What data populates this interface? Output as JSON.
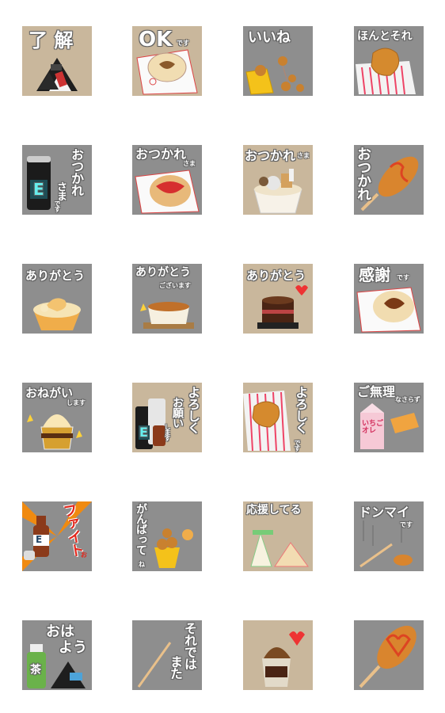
{
  "stickers": [
    {
      "id": "s1",
      "bg": "#c9b79c",
      "text": "了 解",
      "sub": ""
    },
    {
      "id": "s2",
      "bg": "#c9b79c",
      "text": "OK",
      "sub": "です"
    },
    {
      "id": "s3",
      "bg": "#8e8e8e",
      "text": "いいね",
      "sub": ""
    },
    {
      "id": "s4",
      "bg": "#8e8e8e",
      "text": "ほんとそれ",
      "sub": ""
    },
    {
      "id": "s5",
      "bg": "#8e8e8e",
      "text": "おつかれ",
      "sub2": "さま",
      "sub": "です"
    },
    {
      "id": "s6",
      "bg": "#8e8e8e",
      "text": "おつかれ",
      "sub": "さま"
    },
    {
      "id": "s7",
      "bg": "#c9b79c",
      "text": "おつかれ",
      "sub": "さま"
    },
    {
      "id": "s8",
      "bg": "#8e8e8e",
      "text": "おつかれ",
      "sub": ""
    },
    {
      "id": "s9",
      "bg": "#8e8e8e",
      "text": "ありがとう",
      "sub": ""
    },
    {
      "id": "s10",
      "bg": "#8e8e8e",
      "text": "ありがとう",
      "sub": "ございます"
    },
    {
      "id": "s11",
      "bg": "#c9b79c",
      "text": "ありがとう",
      "sub": ""
    },
    {
      "id": "s12",
      "bg": "#8e8e8e",
      "text": "感謝",
      "sub": "です"
    },
    {
      "id": "s13",
      "bg": "#8e8e8e",
      "text": "おねがい",
      "sub": "します"
    },
    {
      "id": "s14",
      "bg": "#c9b79c",
      "text": "よろしく",
      "text2": "お願い",
      "sub": "します"
    },
    {
      "id": "s15",
      "bg": "#c9b79c",
      "text": "よろしく",
      "sub": "です"
    },
    {
      "id": "s16",
      "bg": "#8e8e8e",
      "text": "ご無理",
      "sub": "なさらず"
    },
    {
      "id": "s17",
      "bg": "#8e8e8e",
      "text": "ファイト",
      "sub": "お"
    },
    {
      "id": "s18",
      "bg": "#8e8e8e",
      "text": "がんばって",
      "sub": "ね"
    },
    {
      "id": "s19",
      "bg": "#c9b79c",
      "text": "応援してる",
      "sub": ""
    },
    {
      "id": "s20",
      "bg": "#8e8e8e",
      "text": "ドンマイ",
      "sub": "です"
    },
    {
      "id": "s21",
      "bg": "#8e8e8e",
      "text": "おは",
      "text2": "よう",
      "sub": ""
    },
    {
      "id": "s22",
      "bg": "#8e8e8e",
      "text": "それでは",
      "text2": "また",
      "sub": ""
    },
    {
      "id": "s23",
      "bg": "#c9b79c",
      "text": "",
      "sub": ""
    },
    {
      "id": "s24",
      "bg": "#8e8e8e",
      "text": "",
      "sub": ""
    }
  ],
  "labels": {
    "can_e1": "E",
    "can_e2": "E",
    "bottle_e": "E",
    "milk": "いちご\nオレ",
    "tea": "茶",
    "sandwich": "サンドイッチ",
    "fight_tag": "ENER"
  },
  "colors": {
    "tan": "#c9b79c",
    "gray": "#8e8e8e"
  }
}
